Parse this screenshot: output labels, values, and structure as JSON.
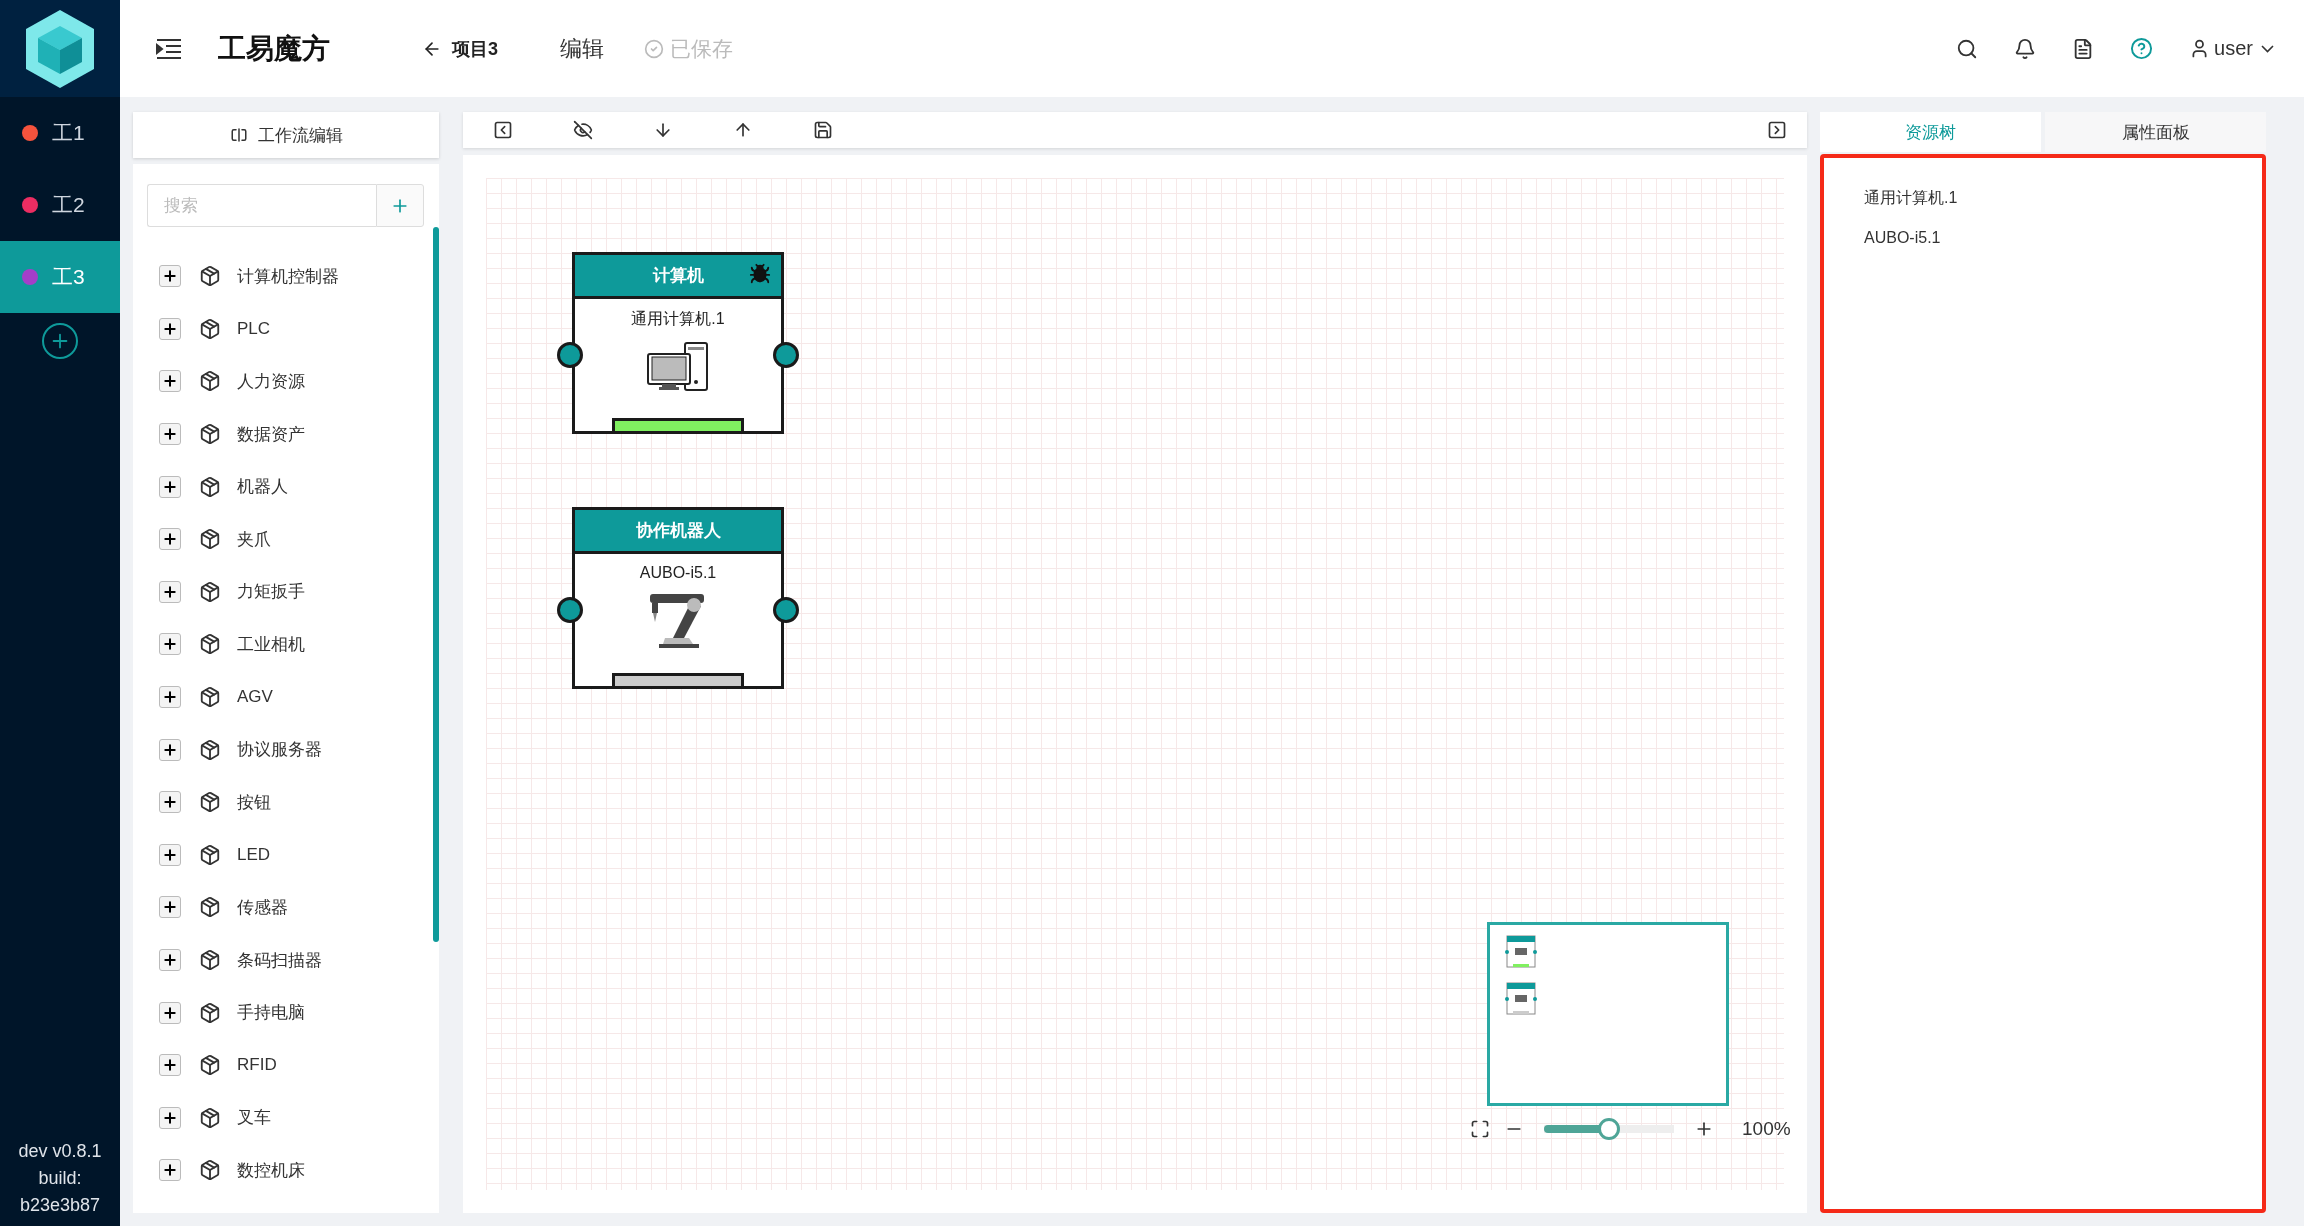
{
  "sidebar": {
    "workspaces": [
      {
        "label": "工1",
        "color": "#f5533d",
        "selected": false
      },
      {
        "label": "工2",
        "color": "#ec2d62",
        "selected": false
      },
      {
        "label": "工3",
        "color": "#a43ec9",
        "selected": true
      }
    ],
    "version": "dev v0.8.1",
    "build_label": "build:",
    "build": "b23e3b87"
  },
  "header": {
    "title": "工易魔方",
    "back_label": "项目3",
    "mode": "编辑",
    "save_status": "已保存",
    "user": "user"
  },
  "library": {
    "title": "工作流编辑",
    "search": {
      "placeholder": "搜索"
    },
    "items": [
      "计算机控制器",
      "PLC",
      "人力资源",
      "数据资产",
      "机器人",
      "夹爪",
      "力矩扳手",
      "工业相机",
      "AGV",
      "协议服务器",
      "按钮",
      "LED",
      "传感器",
      "条码扫描器",
      "手持电脑",
      "RFID",
      "叉车",
      "数控机床"
    ]
  },
  "canvas": {
    "nodes": [
      {
        "kind": "computer",
        "title": "计算机",
        "name": "通用计算机.1",
        "debug": true,
        "color": "#80f060"
      },
      {
        "kind": "robot",
        "title": "协作机器人",
        "name": "AUBO-i5.1",
        "debug": false,
        "color": "#cccccc"
      }
    ],
    "zoom": {
      "level": 0.5,
      "reading": "100%"
    }
  },
  "right_panel": {
    "tabs": [
      {
        "label": "资源树",
        "selected": true
      },
      {
        "label": "属性面板",
        "selected": false
      }
    ],
    "resources": [
      "通用计算机.1",
      "AUBO-i5.1"
    ]
  }
}
